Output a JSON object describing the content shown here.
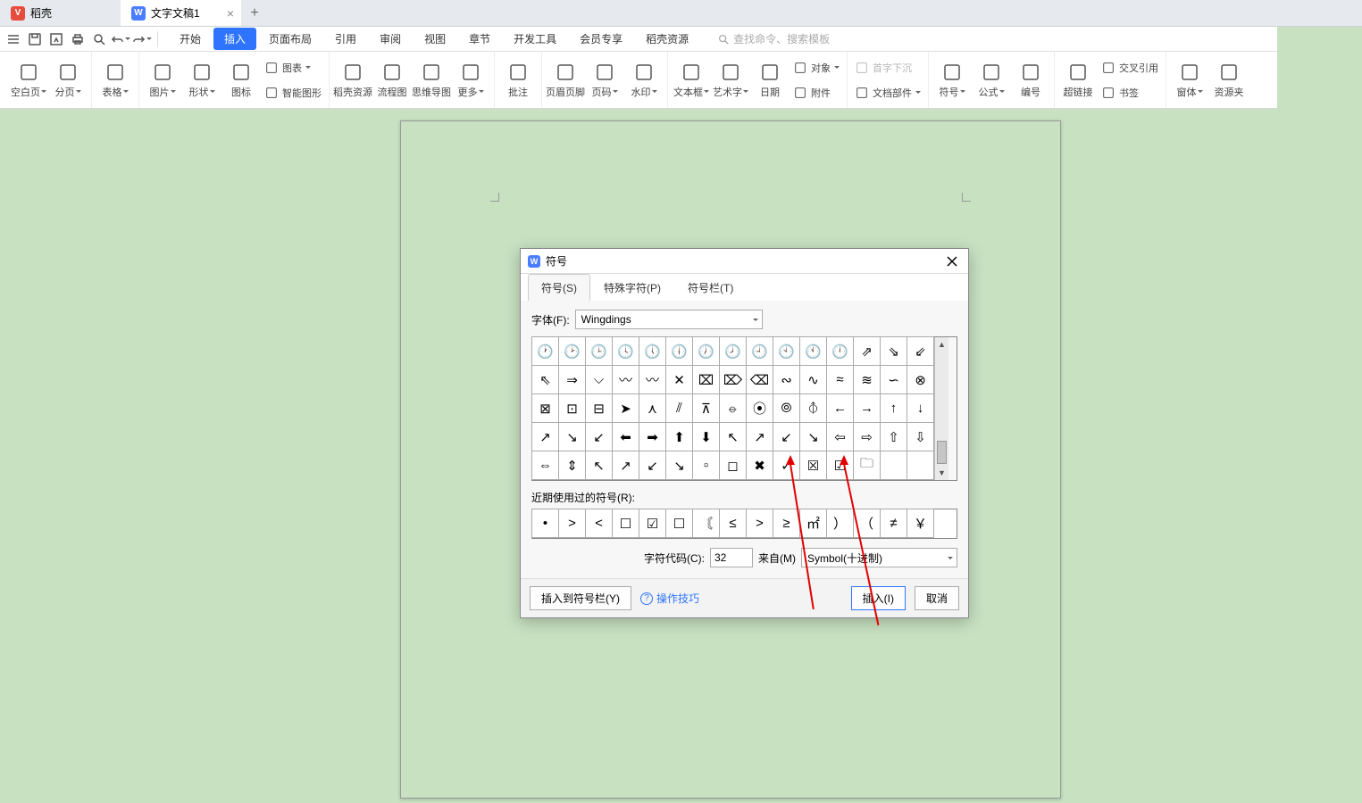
{
  "tabs": {
    "items": [
      {
        "label": "稻壳",
        "icon_color": "#e84c3d"
      },
      {
        "label": "文字文稿1",
        "icon_color": "#4a7dff"
      }
    ],
    "active_index": 1
  },
  "menus": {
    "items": [
      "开始",
      "插入",
      "页面布局",
      "引用",
      "审阅",
      "视图",
      "章节",
      "开发工具",
      "会员专享",
      "稻壳资源"
    ],
    "active": "插入",
    "search_placeholder": "查找命令、搜索模板"
  },
  "ribbon": {
    "g1": [
      {
        "label": "空白页",
        "hasCaret": true
      },
      {
        "label": "分页",
        "hasCaret": true
      }
    ],
    "g2": [
      {
        "label": "表格",
        "hasCaret": true
      }
    ],
    "g3": [
      {
        "label": "图片",
        "hasCaret": true
      },
      {
        "label": "形状",
        "hasCaret": true
      },
      {
        "label": "图标"
      }
    ],
    "g3b_lines": [
      {
        "label": "图表",
        "hasCaret": true
      },
      {
        "label": "智能图形"
      }
    ],
    "g3b_btn": {
      "label": "智能图形"
    },
    "g4": [
      {
        "label": "稻壳资源"
      },
      {
        "label": "流程图"
      },
      {
        "label": "思维导图"
      },
      {
        "label": "更多",
        "hasCaret": true
      }
    ],
    "g5": [
      {
        "label": "批注"
      }
    ],
    "g6": [
      {
        "label": "页眉页脚"
      },
      {
        "label": "页码",
        "hasCaret": true
      },
      {
        "label": "水印",
        "hasCaret": true
      }
    ],
    "g7": [
      {
        "label": "文本框",
        "hasCaret": true
      },
      {
        "label": "艺术字",
        "hasCaret": true
      },
      {
        "label": "日期"
      }
    ],
    "g7b_lines": [
      {
        "label": "对象",
        "hasCaret": true
      },
      {
        "label": "附件"
      }
    ],
    "g8_lines": [
      {
        "label": "首字下沉",
        "dim": true
      },
      {
        "label": "文档部件",
        "hasCaret": true
      }
    ],
    "g9": [
      {
        "label": "符号",
        "hasCaret": true
      },
      {
        "label": "公式",
        "hasCaret": true
      },
      {
        "label": "编号"
      }
    ],
    "g10": [
      {
        "label": "超链接"
      }
    ],
    "g10b_lines": [
      {
        "label": "交叉引用"
      },
      {
        "label": "书签"
      }
    ],
    "g11": [
      {
        "label": "窗体",
        "hasCaret": true
      },
      {
        "label": "资源夹"
      }
    ]
  },
  "dialog": {
    "title": "符号",
    "tabs": [
      "符号(S)",
      "特殊字符(P)",
      "符号栏(T)"
    ],
    "active_tab": 0,
    "font_label": "字体(F):",
    "font_value": "Wingdings",
    "grid": [
      "🕐",
      "🕑",
      "🕒",
      "🕓",
      "🕔",
      "🕕",
      "🕖",
      "🕗",
      "🕘",
      "🕙",
      "🕚",
      "🕛",
      "⇗",
      "⇘",
      "⇙",
      "⇖",
      "⇒",
      "⌵",
      "〰",
      "〰",
      "✕",
      "⌧",
      "⌦",
      "⌫",
      "∾",
      "∿",
      "≈",
      "≋",
      "∽",
      "⊗",
      "⊠",
      "⊡",
      "⊟",
      "➤",
      "⋏",
      "⫽",
      "⊼",
      "⦵",
      "⦿",
      "⦾",
      "⦽",
      "←",
      "→",
      "↑",
      "↓",
      "↗",
      "↘",
      "↙",
      "⬅",
      "➡",
      "⬆",
      "⬇",
      "↖",
      "↗",
      "↙",
      "↘",
      "⇦",
      "⇨",
      "⇧",
      "⇩",
      "⇔",
      "⇕",
      "↖",
      "↗",
      "↙",
      "↘",
      "▫",
      "◻",
      "✖",
      "✓",
      "☒",
      "☑",
      "🗀",
      "",
      ""
    ],
    "recent_label": "近期使用过的符号(R):",
    "recent": [
      "•",
      ">",
      "<",
      "☐",
      "☑",
      "☐",
      "〘",
      "≤",
      ">",
      "≥",
      "㎡",
      "）",
      "（",
      "≠",
      "￥"
    ],
    "code_label": "字符代码(C):",
    "code_value": "32",
    "from_label": "来自(M)",
    "from_value": "Symbol(十进制)",
    "footer": {
      "insert_to_bar": "插入到符号栏(Y)",
      "tips": "操作技巧",
      "insert": "插入(I)",
      "cancel": "取消"
    }
  }
}
